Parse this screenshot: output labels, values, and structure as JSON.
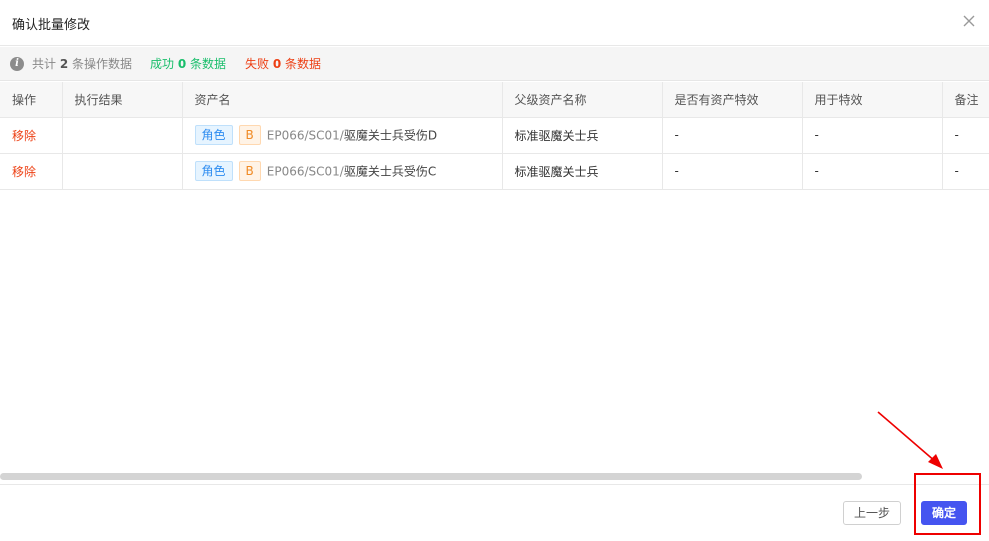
{
  "dialog": {
    "title": "确认批量修改",
    "close_icon": "close-icon"
  },
  "summary": {
    "total_prefix": "共计",
    "total_count": "2",
    "total_suffix": "条操作数据",
    "success_prefix": "成功",
    "success_count": "0",
    "success_suffix": "条数据",
    "fail_prefix": "失败",
    "fail_count": "0",
    "fail_suffix": "条数据",
    "colors": {
      "success": "#19be6b",
      "fail": "#ed3f14"
    }
  },
  "table": {
    "columns": [
      "操作",
      "执行结果",
      "资产名",
      "父级资产名称",
      "是否有资产特效",
      "用于特效",
      "备注"
    ],
    "rows": [
      {
        "action": "移除",
        "result": "",
        "tag_type": "角色",
        "tag_level": "B",
        "asset_path": "EP066/SC01/",
        "asset_name": "驱魔关士兵受伤D",
        "parent": "标准驱魔关士兵",
        "has_effect": "-",
        "for_effect": "-",
        "remark": "-"
      },
      {
        "action": "移除",
        "result": "",
        "tag_type": "角色",
        "tag_level": "B",
        "asset_path": "EP066/SC01/",
        "asset_name": "驱魔关士兵受伤C",
        "parent": "标准驱魔关士兵",
        "has_effect": "-",
        "for_effect": "-",
        "remark": "-"
      }
    ]
  },
  "footer": {
    "prev_label": "上一步",
    "confirm_label": "确定",
    "accent": "#4554f0"
  }
}
